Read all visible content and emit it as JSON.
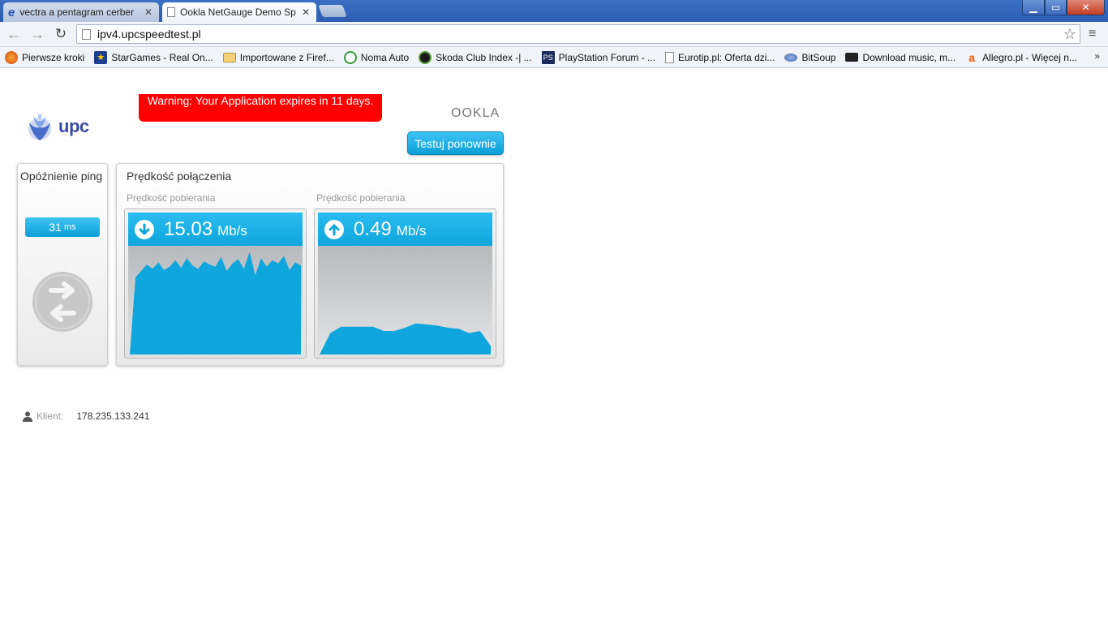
{
  "browser": {
    "tabs": [
      {
        "label": "vectra a pentagram cerber",
        "active": false
      },
      {
        "label": "Ookla NetGauge Demo Sp",
        "active": true
      }
    ],
    "url": "ipv4.upcspeedtest.pl",
    "bookmarks": [
      {
        "label": "Pierwsze kroki",
        "icon": "firefox-icon"
      },
      {
        "label": "StarGames - Real On...",
        "icon": "star-icon"
      },
      {
        "label": "Importowane z Firef...",
        "icon": "folder-icon"
      },
      {
        "label": "Noma Auto",
        "icon": "noma-icon"
      },
      {
        "label": "Skoda Club Index -| ...",
        "icon": "skoda-icon"
      },
      {
        "label": "PlayStation Forum - ...",
        "icon": "playstation-icon"
      },
      {
        "label": "Eurotip.pl: Oferta dzi...",
        "icon": "page-icon"
      },
      {
        "label": "BitSoup",
        "icon": "bitsoup-icon"
      },
      {
        "label": "Download music, m...",
        "icon": "download-icon"
      },
      {
        "label": "Allegro.pl - Więcej n...",
        "icon": "allegro-icon"
      }
    ],
    "bookmarks_more": "»"
  },
  "page": {
    "logo_text": "upc",
    "warning": "Warning: Your Application expires in 11 days.",
    "ookla_logo": "OOKLA",
    "retest_label": "Testuj ponownie",
    "ping": {
      "title": "Opóźnienie ping",
      "value": "31",
      "unit": "ms"
    },
    "speed": {
      "title": "Prędkość połączenia",
      "download": {
        "label": "Prędkość pobierania",
        "value": "15.03",
        "unit": "Mb/s",
        "samples": [
          0,
          72,
          78,
          84,
          80,
          86,
          79,
          82,
          88,
          81,
          90,
          83,
          80,
          87,
          84,
          82,
          91,
          78,
          85,
          89,
          80,
          96,
          74,
          90,
          82,
          88,
          85,
          92,
          79,
          86,
          83
        ]
      },
      "upload": {
        "label": "Prędkość pobierania",
        "value": "0.49",
        "unit": "Mb/s",
        "samples": [
          0,
          20,
          26,
          26,
          26,
          26,
          22,
          22,
          25,
          29,
          28,
          27,
          25,
          24,
          20,
          22,
          8
        ]
      }
    },
    "client": {
      "label": "Klient:",
      "ip": "178.235.133.241"
    }
  },
  "colors": {
    "accent": "#0ea6dd",
    "warning": "#ff0000",
    "logo": "#3b4ea0"
  }
}
